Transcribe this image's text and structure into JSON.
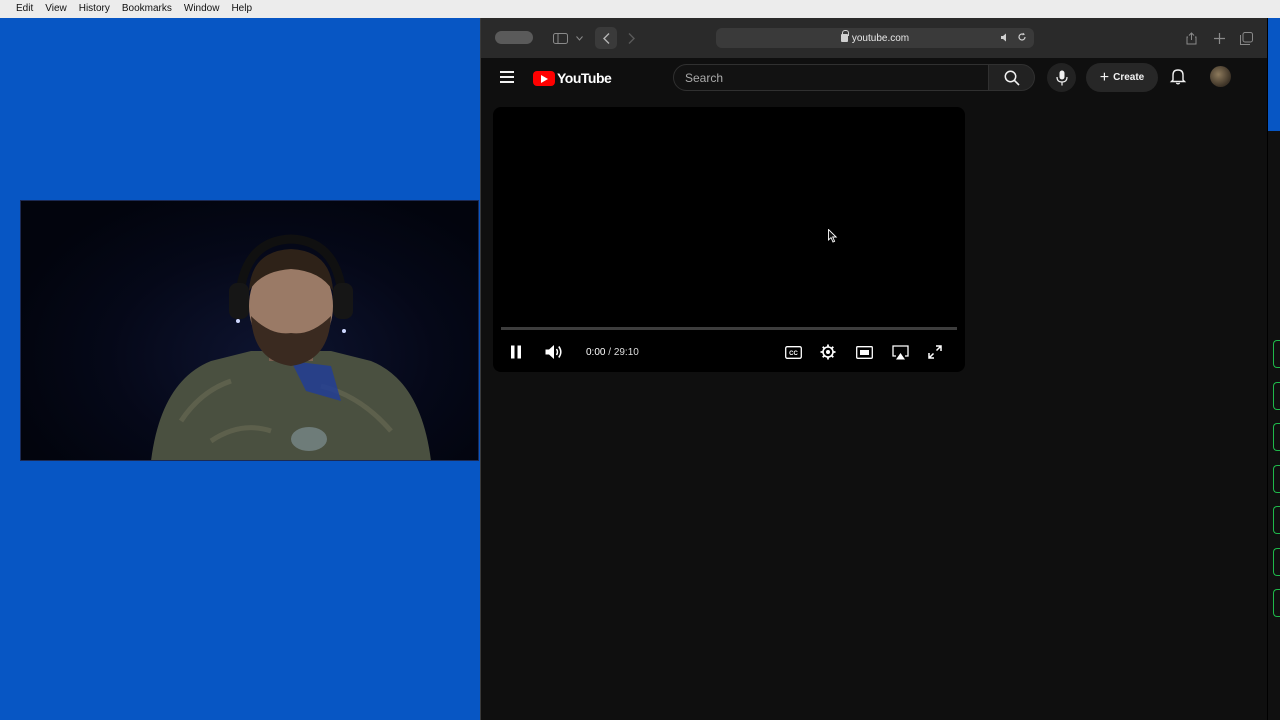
{
  "menubar": {
    "items": [
      "Edit",
      "View",
      "History",
      "Bookmarks",
      "Window",
      "Help"
    ]
  },
  "browser": {
    "url": "youtube.com"
  },
  "youtube": {
    "logo_text": "YouTube",
    "search_placeholder": "Search",
    "create_label": "Create",
    "player": {
      "current_time": "0:00",
      "separator": " / ",
      "duration": "29:10",
      "progress_fraction": 0.0,
      "state": "playing"
    }
  },
  "colors": {
    "desktop": "#0756c4",
    "youtube_bg": "#0f0f0f",
    "brand_red": "#ff0000"
  },
  "icons": [
    "menu-icon",
    "youtube-logo-icon",
    "search-icon",
    "mic-icon",
    "plus-icon",
    "bell-icon",
    "pause-icon",
    "volume-icon",
    "captions-icon",
    "settings-icon",
    "miniplayer-icon",
    "airplay-icon",
    "fullscreen-icon",
    "lock-icon"
  ]
}
